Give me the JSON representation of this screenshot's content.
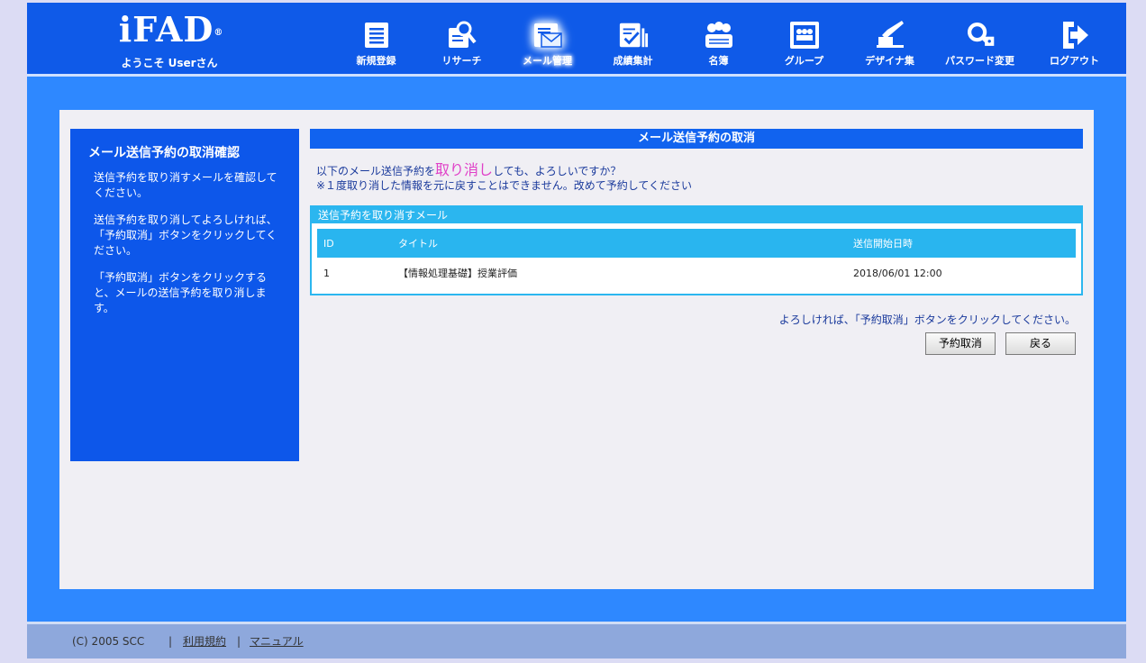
{
  "header": {
    "logo_text": "iFAD",
    "logo_mark": "®",
    "welcome": "ようこそ Userさん",
    "nav": [
      {
        "label": "新規登録",
        "icon": "new-register-icon",
        "active": false
      },
      {
        "label": "リサーチ",
        "icon": "research-icon",
        "active": false
      },
      {
        "label": "メール管理",
        "icon": "mail-manage-icon",
        "active": true
      },
      {
        "label": "成績集計",
        "icon": "grade-summary-icon",
        "active": false
      },
      {
        "label": "名簿",
        "icon": "roster-icon",
        "active": false
      },
      {
        "label": "グループ",
        "icon": "group-icon",
        "active": false
      },
      {
        "label": "デザイナ集",
        "icon": "designer-icon",
        "active": false
      },
      {
        "label": "パスワード変更",
        "icon": "password-change-icon",
        "active": false
      },
      {
        "label": "ログアウト",
        "icon": "logout-icon",
        "active": false
      }
    ]
  },
  "sidebar": {
    "title": "メール送信予約の取消確認",
    "paragraphs": [
      "送信予約を取り消すメールを確認してください。",
      "送信予約を取り消してよろしければ、「予約取消」ボタンをクリックしてください。",
      "「予約取消」ボタンをクリックすると、メールの送信予約を取り消します。"
    ]
  },
  "content": {
    "title": "メール送信予約の取消",
    "message_pre": "以下のメール送信予約を",
    "message_emph": "取り消し",
    "message_post": "しても、よろしいですか？",
    "warning": "※１度取り消した情報を元に戻すことはできません。改めて予約してください",
    "box_title": "送信予約を取り消すメール",
    "table": {
      "headers": [
        "ID",
        "タイトル",
        "送信開始日時"
      ],
      "rows": [
        [
          "1",
          "【情報処理基礎】授業評価",
          "2018/06/01 12:00"
        ]
      ]
    },
    "note": "よろしければ、「予約取消」ボタンをクリックしてください。",
    "cancel_button": "予約取消",
    "back_button": "戻る"
  },
  "footer": {
    "copyright": "(C) 2005 SCC",
    "separator": "|",
    "terms": "利用規約",
    "manual": "マニュアル"
  }
}
